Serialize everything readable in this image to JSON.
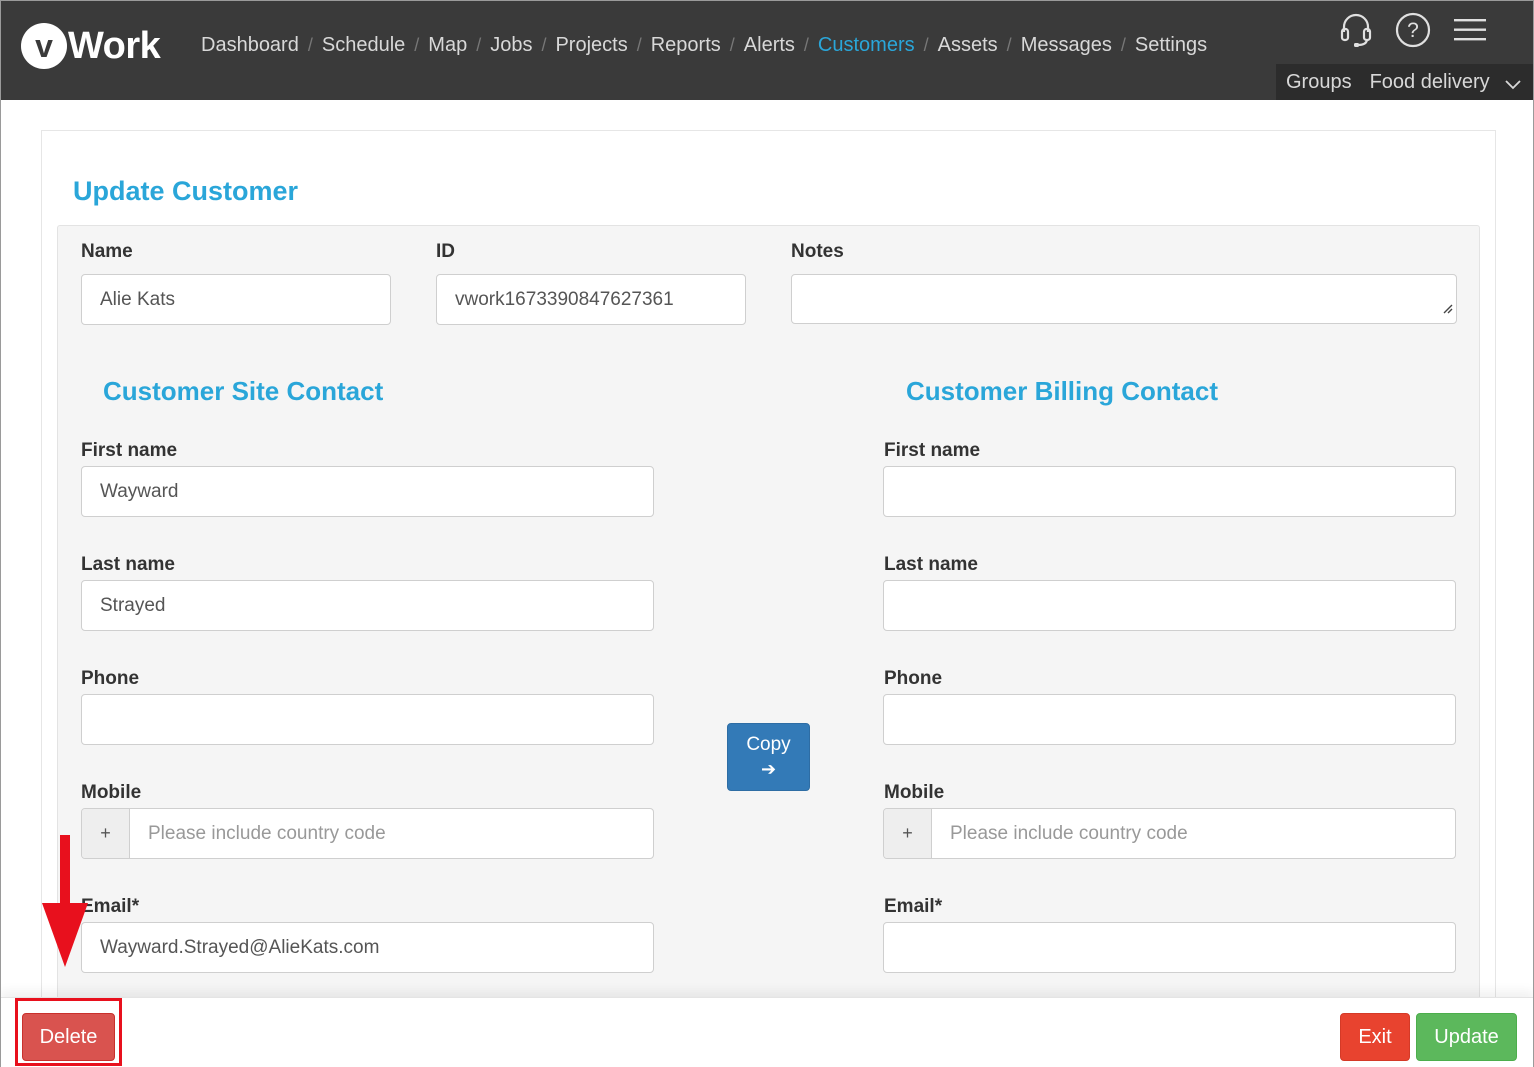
{
  "header": {
    "logo_mark": "v",
    "logo_text": "Work",
    "nav": [
      {
        "label": "Dashboard",
        "active": false
      },
      {
        "label": "Schedule",
        "active": false
      },
      {
        "label": "Map",
        "active": false
      },
      {
        "label": "Jobs",
        "active": false
      },
      {
        "label": "Projects",
        "active": false
      },
      {
        "label": "Reports",
        "active": false
      },
      {
        "label": "Alerts",
        "active": false
      },
      {
        "label": "Customers",
        "active": true
      },
      {
        "label": "Assets",
        "active": false
      },
      {
        "label": "Messages",
        "active": false
      },
      {
        "label": "Settings",
        "active": false
      }
    ],
    "nav_separator": "/",
    "icons": [
      "headset-icon",
      "help-icon",
      "menu-icon"
    ],
    "groups_label": "Groups",
    "groups_value": "Food delivery"
  },
  "form": {
    "title": "Update Customer",
    "name_label": "Name",
    "name_value": "Alie Kats",
    "id_label": "ID",
    "id_value": "vwork1673390847627361",
    "notes_label": "Notes",
    "notes_value": ""
  },
  "site_contact": {
    "title": "Customer Site Contact",
    "first_name_label": "First name",
    "first_name_value": "Wayward",
    "last_name_label": "Last name",
    "last_name_value": "Strayed",
    "phone_label": "Phone",
    "phone_value": "",
    "mobile_label": "Mobile",
    "mobile_prefix": "+",
    "mobile_placeholder": "Please include country code",
    "email_label": "Email*",
    "email_value": "Wayward.Strayed@AlieKats.com"
  },
  "billing_contact": {
    "title": "Customer Billing Contact",
    "first_name_label": "First name",
    "first_name_value": "",
    "last_name_label": "Last name",
    "last_name_value": "",
    "phone_label": "Phone",
    "phone_value": "",
    "mobile_label": "Mobile",
    "mobile_prefix": "+",
    "mobile_placeholder": "Please include country code",
    "email_label": "Email*",
    "email_value": ""
  },
  "copy_button": {
    "label": "Copy",
    "arrow": "➔"
  },
  "footer": {
    "delete_label": "Delete",
    "exit_label": "Exit",
    "update_label": "Update"
  },
  "colors": {
    "accent": "#2aa6d9",
    "topbar": "#3a3a3a",
    "delete": "#d9534f",
    "exit": "#e8432f",
    "update": "#5cb85c",
    "copy": "#337ab7",
    "annotation": "#e8101d"
  }
}
